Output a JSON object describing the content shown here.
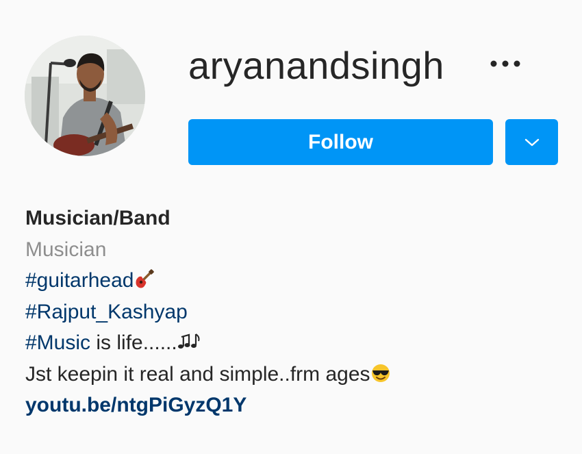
{
  "profile": {
    "username": "aryanandsingh",
    "follow_label": "Follow"
  },
  "bio": {
    "category": "Musician/Band",
    "subcategory": "Musician",
    "line1_hashtag": "#guitarhead",
    "line1_emoji": "guitar-emoji",
    "line2_hashtag": "#Rajput_Kashyap",
    "line3_hashtag": "#Music",
    "line3_text": " is life......",
    "line3_emoji": "musical-notes-emoji",
    "line4_text": "Jst keepin it real and simple..frm ages",
    "line4_emoji": "sunglasses-face-emoji",
    "link": "youtu.be/ntgPiGyzQ1Y"
  },
  "icons": {
    "more": "more-horizontal-icon",
    "dropdown": "chevron-down-icon"
  },
  "colors": {
    "primary_button": "#0095f6",
    "link_text": "#00376b",
    "secondary_text": "#8e8e8e",
    "primary_text": "#262626",
    "background": "#fafafa"
  }
}
